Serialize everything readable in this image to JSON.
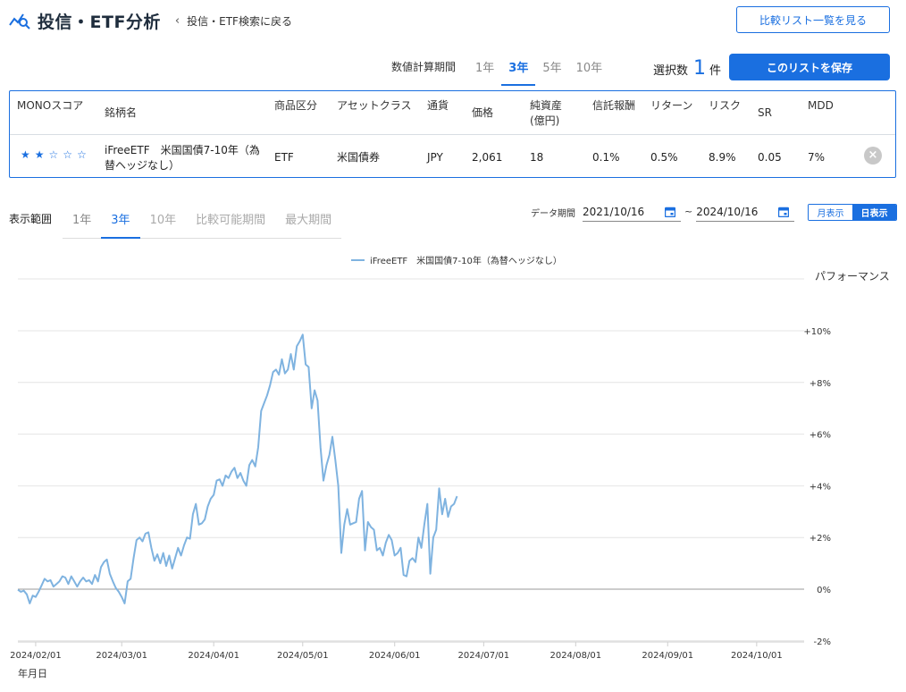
{
  "header": {
    "title": "投信・ETF分析",
    "back_label": "投信・ETF検索に戻る",
    "compare_list_label": "比較リスト一覧を見る"
  },
  "period_selector": {
    "label": "数値計算期間",
    "tabs": [
      "1年",
      "3年",
      "5年",
      "10年"
    ],
    "active": "3年"
  },
  "selection": {
    "prefix": "選択数",
    "count": "1",
    "suffix": "件",
    "save_label": "このリストを保存"
  },
  "table": {
    "headers": {
      "score": "MONOスコア",
      "name": "銘柄名",
      "product": "商品区分",
      "asset": "アセットクラス",
      "currency": "通貨",
      "price": "価格",
      "net_assets_1": "純資産",
      "net_assets_2": "(億円)",
      "fee": "信託報酬",
      "return": "リターン",
      "risk": "リスク",
      "sr": "SR",
      "mdd": "MDD"
    },
    "rows": [
      {
        "stars": 2,
        "name_1": "iFreeETF　米国国債7-10年（為",
        "name_2": "替ヘッジなし）",
        "product": "ETF",
        "asset": "米国債券",
        "currency": "JPY",
        "price": "2,061",
        "net_assets": "18",
        "fee": "0.1%",
        "return": "0.5%",
        "risk": "8.9%",
        "sr": "0.05",
        "mdd": "7%"
      }
    ]
  },
  "range": {
    "label": "表示範囲",
    "tabs": [
      "1年",
      "3年",
      "10年",
      "比較可能期間",
      "最大期間"
    ],
    "active": "3年"
  },
  "data_period": {
    "label": "データ期間",
    "start": "2021/10/16",
    "separator": "~",
    "end": "2024/10/16"
  },
  "view_toggle": {
    "monthly": "月表示",
    "daily": "日表示",
    "active": "日表示"
  },
  "colors": {
    "accent": "#1a6fe0",
    "series": "#7fb3e0"
  },
  "chart_data": {
    "type": "line",
    "legend": "iFreeETF　米国国債7-10年（為替ヘッジなし）",
    "ylabel": "パフォーマンス",
    "xlabel": "年月日",
    "ylim": [
      -2,
      12
    ],
    "yticks": [
      "+10%",
      "+8%",
      "+6%",
      "+4%",
      "+2%",
      "0%",
      "-2%"
    ],
    "ytick_values": [
      10,
      8,
      6,
      4,
      2,
      0,
      -2
    ],
    "x_ticks": [
      "2024/02/01",
      "2024/03/01",
      "2024/04/01",
      "2024/05/01",
      "2024/06/01",
      "2024/07/01",
      "2024/08/01",
      "2024/09/01",
      "2024/10/01"
    ],
    "x_tick_days": [
      31,
      60,
      91,
      121,
      152,
      182,
      213,
      244,
      274
    ],
    "x_day_range": [
      25,
      290
    ],
    "grid": true,
    "legend_position": "top-center",
    "series": [
      {
        "name": "iFreeETF　米国国債7-10年（為替ヘッジなし）",
        "points": [
          [
            25,
            -0.02
          ],
          [
            26,
            -0.1
          ],
          [
            27,
            -0.06
          ],
          [
            28,
            -0.2
          ],
          [
            29,
            -0.55
          ],
          [
            30,
            -0.25
          ],
          [
            31,
            -0.3
          ],
          [
            32,
            -0.1
          ],
          [
            33,
            0.15
          ],
          [
            34,
            0.4
          ],
          [
            35,
            0.3
          ],
          [
            36,
            0.35
          ],
          [
            37,
            0.1
          ],
          [
            38,
            0.2
          ],
          [
            39,
            0.3
          ],
          [
            40,
            0.5
          ],
          [
            41,
            0.45
          ],
          [
            42,
            0.2
          ],
          [
            43,
            0.5
          ],
          [
            44,
            0.3
          ],
          [
            45,
            0.1
          ],
          [
            46,
            0.3
          ],
          [
            47,
            0.45
          ],
          [
            48,
            0.3
          ],
          [
            49,
            0.35
          ],
          [
            50,
            0.2
          ],
          [
            51,
            0.55
          ],
          [
            52,
            0.3
          ],
          [
            53,
            0.85
          ],
          [
            54,
            1.05
          ],
          [
            55,
            1.15
          ],
          [
            56,
            0.6
          ],
          [
            57,
            0.3
          ],
          [
            58,
            0.05
          ],
          [
            59,
            -0.1
          ],
          [
            60,
            -0.3
          ],
          [
            61,
            -0.55
          ],
          [
            62,
            0.3
          ],
          [
            63,
            0.4
          ],
          [
            64,
            1.2
          ],
          [
            65,
            1.9
          ],
          [
            66,
            2.0
          ],
          [
            67,
            1.85
          ],
          [
            68,
            2.15
          ],
          [
            69,
            2.2
          ],
          [
            70,
            1.6
          ],
          [
            71,
            1.1
          ],
          [
            72,
            1.35
          ],
          [
            73,
            1.0
          ],
          [
            74,
            1.4
          ],
          [
            75,
            0.9
          ],
          [
            76,
            1.3
          ],
          [
            77,
            0.8
          ],
          [
            78,
            1.2
          ],
          [
            79,
            1.6
          ],
          [
            80,
            1.3
          ],
          [
            81,
            1.7
          ],
          [
            82,
            2.0
          ],
          [
            83,
            1.95
          ],
          [
            84,
            2.9
          ],
          [
            85,
            3.3
          ],
          [
            86,
            2.5
          ],
          [
            87,
            2.55
          ],
          [
            88,
            2.7
          ],
          [
            89,
            3.2
          ],
          [
            90,
            3.5
          ],
          [
            91,
            3.65
          ],
          [
            92,
            4.2
          ],
          [
            93,
            4.25
          ],
          [
            94,
            4.0
          ],
          [
            95,
            4.4
          ],
          [
            96,
            4.3
          ],
          [
            97,
            4.55
          ],
          [
            98,
            4.7
          ],
          [
            99,
            4.3
          ],
          [
            100,
            4.5
          ],
          [
            101,
            4.2
          ],
          [
            102,
            4.0
          ],
          [
            103,
            4.8
          ],
          [
            104,
            5.0
          ],
          [
            105,
            4.75
          ],
          [
            106,
            5.5
          ],
          [
            107,
            6.9
          ],
          [
            108,
            7.2
          ],
          [
            109,
            7.5
          ],
          [
            110,
            7.9
          ],
          [
            111,
            8.4
          ],
          [
            112,
            8.5
          ],
          [
            113,
            8.3
          ],
          [
            114,
            8.9
          ],
          [
            115,
            8.35
          ],
          [
            116,
            8.5
          ],
          [
            117,
            9.1
          ],
          [
            118,
            8.5
          ],
          [
            119,
            9.4
          ],
          [
            120,
            9.6
          ],
          [
            121,
            9.85
          ],
          [
            122,
            8.7
          ],
          [
            123,
            8.6
          ],
          [
            124,
            7.0
          ],
          [
            125,
            7.7
          ],
          [
            126,
            7.3
          ],
          [
            127,
            5.5
          ],
          [
            128,
            4.2
          ],
          [
            129,
            4.8
          ],
          [
            130,
            5.2
          ],
          [
            131,
            5.9
          ],
          [
            132,
            5.0
          ],
          [
            133,
            4.0
          ],
          [
            134,
            1.4
          ],
          [
            135,
            2.5
          ],
          [
            136,
            3.1
          ],
          [
            137,
            2.5
          ],
          [
            138,
            2.55
          ],
          [
            139,
            2.6
          ],
          [
            140,
            3.5
          ],
          [
            141,
            3.8
          ],
          [
            142,
            1.5
          ],
          [
            143,
            2.6
          ],
          [
            144,
            2.4
          ],
          [
            145,
            2.3
          ],
          [
            146,
            1.5
          ],
          [
            147,
            1.6
          ],
          [
            148,
            1.3
          ],
          [
            149,
            1.8
          ],
          [
            150,
            2.1
          ],
          [
            151,
            1.9
          ],
          [
            152,
            1.3
          ],
          [
            153,
            1.4
          ],
          [
            154,
            1.6
          ],
          [
            155,
            0.55
          ],
          [
            156,
            0.5
          ],
          [
            157,
            1.1
          ],
          [
            158,
            1.2
          ],
          [
            159,
            1.05
          ],
          [
            160,
            2.0
          ],
          [
            161,
            1.6
          ],
          [
            162,
            2.5
          ],
          [
            163,
            3.3
          ],
          [
            164,
            0.6
          ],
          [
            165,
            2.0
          ],
          [
            166,
            2.3
          ],
          [
            167,
            3.9
          ],
          [
            168,
            2.9
          ],
          [
            169,
            3.5
          ],
          [
            170,
            2.8
          ],
          [
            171,
            3.2
          ],
          [
            172,
            3.3
          ],
          [
            173,
            3.6
          ]
        ]
      }
    ]
  }
}
